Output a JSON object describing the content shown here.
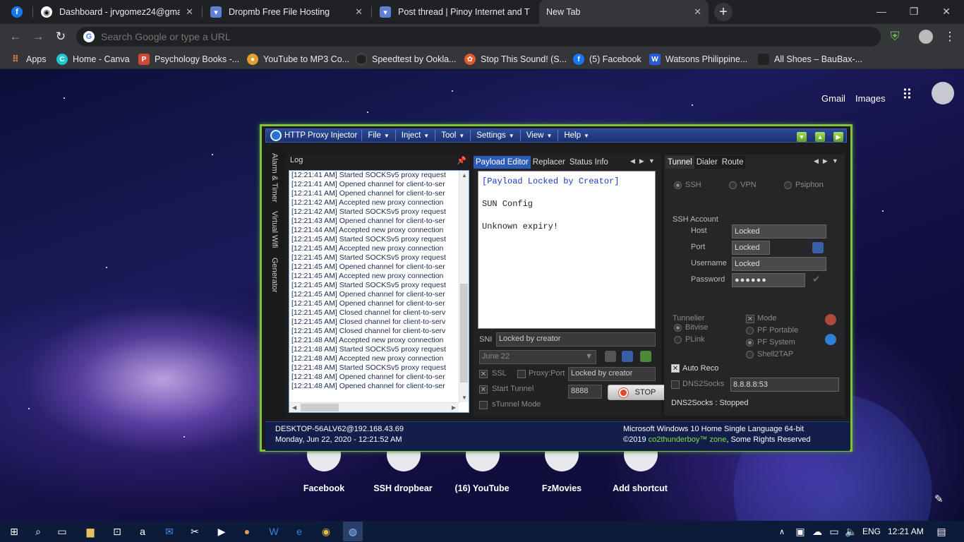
{
  "browser": {
    "tabs": [
      {
        "title": "",
        "icon": "facebook-icon",
        "color": "#1877f2"
      },
      {
        "title": "Dashboard - jrvgomez24@gmail",
        "icon": "github-icon",
        "color": "#ffffff"
      },
      {
        "title": "Dropmb Free File Hosting",
        "icon": "dropmb-icon",
        "color": "#8aa8ff"
      },
      {
        "title": "Post thread | Pinoy Internet and T",
        "icon": "phcorner-icon",
        "color": "#8aa8ff"
      },
      {
        "title": "New Tab",
        "icon": "",
        "color": ""
      }
    ],
    "omnibox_placeholder": "Search Google or type a URL",
    "bookmarks": [
      {
        "label": "Apps",
        "icon": "apps-grid-icon",
        "color": "#4285f4"
      },
      {
        "label": "Home - Canva",
        "icon": "canva-icon",
        "color": "#20c4cb"
      },
      {
        "label": "Psychology Books -...",
        "icon": "pdf-icon",
        "color": "#d04a3a"
      },
      {
        "label": "YouTube to MP3 Co...",
        "icon": "converter-icon",
        "color": "#e0a030"
      },
      {
        "label": "Speedtest by Ookla...",
        "icon": "speedtest-icon",
        "color": "#222222"
      },
      {
        "label": "Stop This Sound! (S...",
        "icon": "stop-sound-icon",
        "color": "#e05a2a"
      },
      {
        "label": "(5) Facebook",
        "icon": "facebook-icon",
        "color": "#1877f2"
      },
      {
        "label": "Watsons Philippine...",
        "icon": "watsons-icon",
        "color": "#2a5bd8"
      },
      {
        "label": "All Shoes – BauBax-...",
        "icon": "baubax-icon",
        "color": "#222222"
      }
    ]
  },
  "newtab": {
    "links": {
      "gmail": "Gmail",
      "images": "Images"
    },
    "shortcuts": [
      "Facebook",
      "SSH dropbear",
      "(16) YouTube",
      "FzMovies",
      "Add shortcut"
    ]
  },
  "injector": {
    "title": "HTTP Proxy Injector",
    "menus": [
      "File",
      "Inject",
      "Tool",
      "Settings",
      "View",
      "Help"
    ],
    "side_tabs": [
      "Alarm & Timer",
      "Virtual Wifi",
      "Generator"
    ],
    "log_title": "Log",
    "log_lines": [
      "[12:21:41 AM] Started SOCKSv5 proxy request",
      "[12:21:41 AM] Opened channel for client-to-ser",
      "[12:21:41 AM] Opened channel for client-to-ser",
      "[12:21:42 AM] Accepted new proxy connection",
      "[12:21:42 AM] Started SOCKSv5 proxy request",
      "[12:21:43 AM] Opened channel for client-to-ser",
      "[12:21:44 AM] Accepted new proxy connection",
      "[12:21:45 AM] Started SOCKSv5 proxy request",
      "[12:21:45 AM] Accepted new proxy connection",
      "[12:21:45 AM] Started SOCKSv5 proxy request",
      "[12:21:45 AM] Opened channel for client-to-ser",
      "[12:21:45 AM] Accepted new proxy connection",
      "[12:21:45 AM] Started SOCKSv5 proxy request",
      "[12:21:45 AM] Opened channel for client-to-ser",
      "[12:21:45 AM] Opened channel for client-to-ser",
      "[12:21:45 AM] Closed channel for client-to-serv",
      "[12:21:45 AM] Closed channel for client-to-serv",
      "[12:21:45 AM] Closed channel for client-to-serv",
      "[12:21:48 AM] Accepted new proxy connection",
      "[12:21:48 AM] Started SOCKSv5 proxy request",
      "[12:21:48 AM] Accepted new proxy connection",
      "[12:21:48 AM] Started SOCKSv5 proxy request",
      "[12:21:48 AM] Opened channel for client-to-ser",
      "[12:21:48 AM] Opened channel for client-to-ser"
    ],
    "mid_tabs": [
      "Payload Editor",
      "Replacer",
      "Status Info"
    ],
    "payload_lines": [
      "[Payload Locked by Creator]",
      "",
      "SUN Config",
      "",
      "Unknown expiry!"
    ],
    "sni_label": "SNI",
    "sni_value": "Locked by creator",
    "date_value": "June 22",
    "ssl_label": "SSL",
    "proxy_port_label": "Proxy:Port",
    "proxy_port_value": "Locked by creator",
    "start_tunnel_label": "Start Tunnel",
    "port_value": "8888",
    "stop_label": "STOP",
    "stunnel_label": "sTunnel Mode",
    "right_tabs": [
      "Tunnel",
      "Dialer",
      "Route"
    ],
    "protocols": [
      "SSH",
      "VPN",
      "Psiphon"
    ],
    "ssh_account_label": "SSH Account",
    "host_label": "Host",
    "host_value": "Locked",
    "port_label": "Port",
    "port_field_value": "Locked",
    "username_label": "Username",
    "username_value": "Locked",
    "password_label": "Password",
    "password_value": "●●●●●●",
    "tunnelier_label": "Tunnelier",
    "bitvise_label": "Bitvise",
    "plink_label": "PLink",
    "mode_label": "Mode",
    "pf_portable_label": "PF Portable",
    "pf_system_label": "PF System",
    "shell2tap_label": "Shell2TAP",
    "auto_reco_label": "Auto Reco",
    "dns2socks_label": "DNS2Socks",
    "dns_value": "8.8.8.8:53",
    "dns_status": "DNS2Socks : Stopped",
    "footer": {
      "host": "DESKTOP-56ALV62@192.168.43.69",
      "datetime": "Monday, Jun 22, 2020 - 12:21:52 AM",
      "os": "Microsoft Windows 10 Home Single Language 64-bit",
      "copyright_prefix": "©2019",
      "copyright_brand": "co2thunderboy™ zone",
      "copyright_suffix": ", Some Rights Reserved"
    },
    "accent_green": "#7fc241"
  },
  "taskbar": {
    "language": "ENG",
    "time": "12:21 AM"
  }
}
